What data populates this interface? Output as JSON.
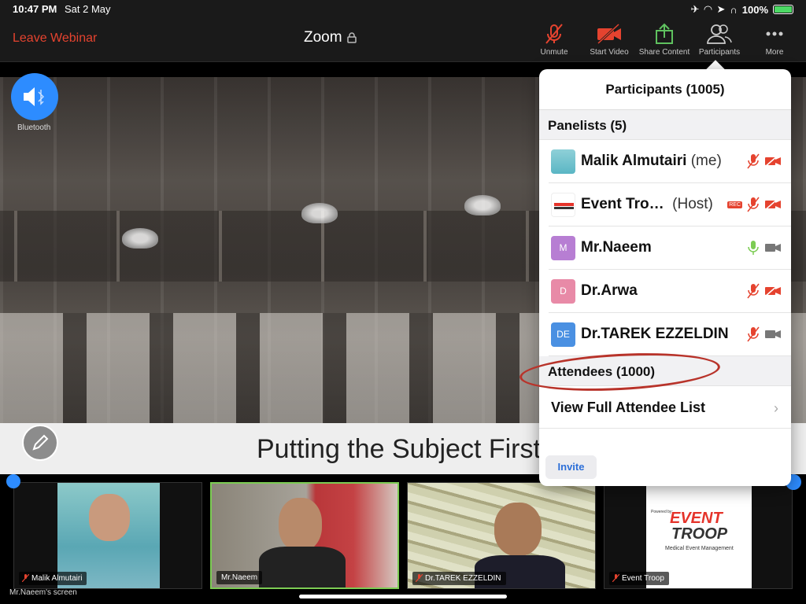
{
  "statusbar": {
    "time": "10:47 PM",
    "date": "Sat 2 May",
    "battery": "100%"
  },
  "toolbar": {
    "leave": "Leave Webinar",
    "title": "Zoom",
    "unmute": "Unmute",
    "start_video": "Start Video",
    "share_content": "Share Content",
    "participants": "Participants",
    "more": "More"
  },
  "share": {
    "speaker_label": "Bluetooth",
    "caption": "Putting the Subject First",
    "screen_label": "Mr.Naeem's screen"
  },
  "videos": [
    {
      "name": "Malik Almutairi"
    },
    {
      "name": "Mr.Naeem"
    },
    {
      "name": "Dr.TAREK EZZELDIN"
    },
    {
      "name": "Event Troop"
    }
  ],
  "participants_panel": {
    "header": "Participants (1005)",
    "panelists_header": "Panelists (5)",
    "panelists": [
      {
        "name": "Malik Almutairi",
        "tag": "(me)",
        "avatar": ""
      },
      {
        "name": "Event Tro…",
        "tag": "(Host)",
        "avatar": "",
        "rec": "REC"
      },
      {
        "name": "Mr.Naeem",
        "tag": "",
        "avatar": "M"
      },
      {
        "name": "Dr.Arwa",
        "tag": "",
        "avatar": "D"
      },
      {
        "name": "Dr.TAREK EZZELDIN",
        "tag": "",
        "avatar": "DE"
      }
    ],
    "attendees_header": "Attendees (1000)",
    "full_list": "View Full Attendee List",
    "invite": "Invite"
  },
  "tile_logo": {
    "powered": "Powered by:",
    "brand1": "EVENT",
    "brand2": "TROOP",
    "sub": "Medical Event Management"
  },
  "colors": {
    "accent": "#2d8cff",
    "danger": "#e5432f",
    "active": "#7ccc53",
    "mic_on": "#7ccc53"
  }
}
